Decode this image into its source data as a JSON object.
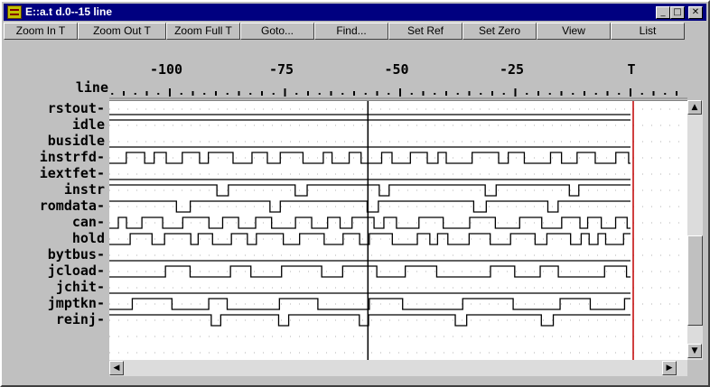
{
  "window": {
    "title": "E::a.t d.0--15 line"
  },
  "titlebar": {
    "minimize_label": "_",
    "maximize_label": "□",
    "close_label": "✕"
  },
  "toolbar": {
    "zoom_in": "Zoom In T",
    "zoom_out": "Zoom Out T",
    "zoom_full": "Zoom Full T",
    "goto": "Goto...",
    "find": "Find...",
    "set_ref": "Set Ref",
    "set_zero": "Set Zero",
    "view": "View",
    "list": "List"
  },
  "ruler": {
    "name": "line",
    "tick_labels": [
      "-100",
      "-75",
      "-50",
      "-25",
      "T"
    ],
    "tick_values": [
      -100,
      -75,
      -50,
      -25,
      0
    ]
  },
  "signals": [
    "rstout-",
    "idle",
    "busidle",
    "instrfd-",
    "iextfet-",
    "instr",
    "romdata-",
    "can-",
    "hold",
    "bytbus-",
    "jcload-",
    "jchit-",
    "jmptkn-",
    "reinj-"
  ],
  "scrollbars": {
    "up": "▲",
    "down": "▼",
    "left": "◀",
    "right": "▶"
  },
  "cursor": {
    "time": -57
  },
  "trigger_line_color": "#c00000",
  "cursor_color": "#000000"
}
